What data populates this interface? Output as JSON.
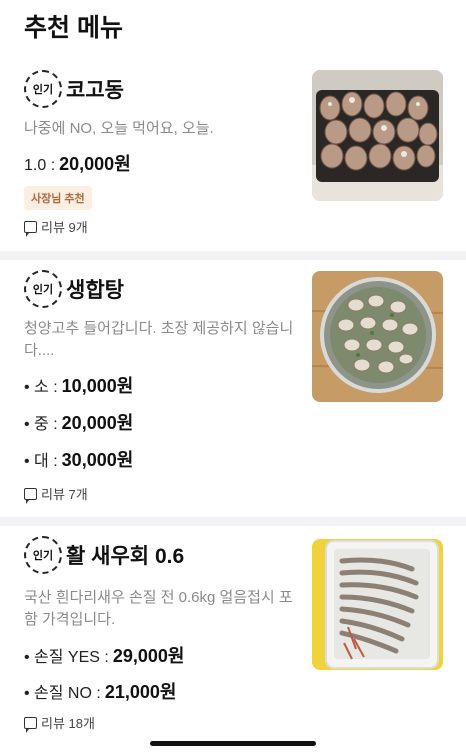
{
  "page": {
    "title": "추천 메뉴"
  },
  "popular_badge": "인기",
  "items": [
    {
      "name": "코고동",
      "description": "나중에 NO, 오늘 먹어요, 오늘.",
      "prices": [
        {
          "label": "1.0 :",
          "value": "20,000원"
        }
      ],
      "owner_badge": "사장님 추천",
      "review": "리뷰 9개",
      "photo": "sea-snails-photo"
    },
    {
      "name": "생합탕",
      "description": "청양고추 들어갑니다. 초장 제공하지 않습니다....",
      "prices": [
        {
          "label": "• 소 :",
          "value": "10,000원"
        },
        {
          "label": "• 중 :",
          "value": "20,000원"
        },
        {
          "label": "• 대 :",
          "value": "30,000원"
        }
      ],
      "review": "리뷰 7개",
      "photo": "clam-soup-photo"
    },
    {
      "name": "활 새우회 0.6",
      "description": "국산 흰다리새우 손질 전 0.6kg 얼음접시 포함 가격입니다.",
      "prices": [
        {
          "label": "• 손질 YES :",
          "value": "29,000원"
        },
        {
          "label": "• 손질 NO :",
          "value": "21,000원"
        }
      ],
      "review": "리뷰 18개",
      "photo": "raw-shrimp-photo"
    }
  ],
  "icons": {
    "review": "chat-bubble-icon",
    "popular": "popular-badge-icon"
  }
}
